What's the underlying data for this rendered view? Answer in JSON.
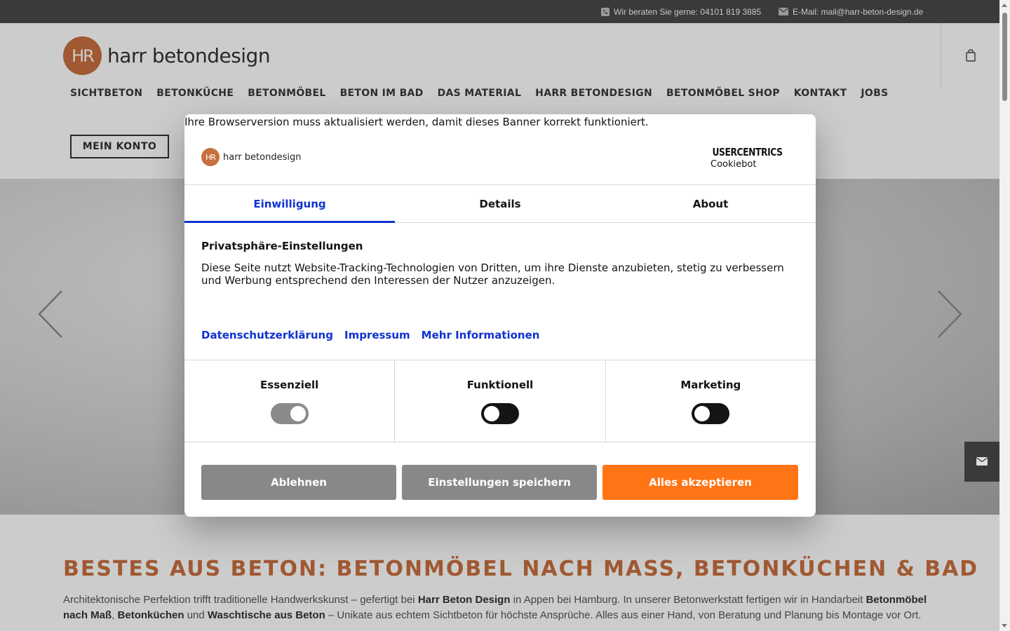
{
  "topbar": {
    "phone_text": "Wir beraten Sie gerne: 04101 819 3885",
    "email_text": "E-Mail: mail@harr-beton-design.de",
    "phone_icon": "phone-icon",
    "email_icon": "envelope-icon"
  },
  "header": {
    "logo_mark": "HR",
    "logo_text": "harr betondesign",
    "nav": [
      "SICHTBETON",
      "BETONKÜCHE",
      "BETONMÖBEL",
      "BETON IM BAD",
      "DAS MATERIAL",
      "HARR BETONDESIGN",
      "BETONMÖBEL SHOP",
      "KONTAKT",
      "JOBS"
    ],
    "account_label": "MEIN KONTO",
    "cart_icon": "shopping-bag-icon"
  },
  "hero": {
    "prev_icon": "chevron-left-icon",
    "next_icon": "chevron-right-icon",
    "side_icon": "envelope-icon"
  },
  "content": {
    "heading": "BESTES AUS BETON: BETONMÖBEL NACH MASS, BETONKÜCHEN & BAD",
    "para": {
      "t1": "Architektonische Perfektion trifft traditionelle Handwerkskunst – gefertigt bei ",
      "b1": "Harr Beton Design",
      "t2": " in Appen bei Hamburg. In unserer Betonwerkstatt fertigen wir in Handarbeit ",
      "b2": "Betonmöbel nach Maß",
      "t3": ", ",
      "b3": "Betonküchen",
      "t4": " und ",
      "b4": "Waschtische aus Beton",
      "t5": " – Unikate aus echtem Sichtbeton für höchste Ansprüche. Alles aus einer Hand, von Beratung und Planung bis Montage vor Ort."
    }
  },
  "dialog": {
    "browser_note": "Ihre Browserversion muss aktualisiert werden, damit dieses Banner korrekt funktioniert.",
    "logo_mark": "HR",
    "logo_text": "harr betondesign",
    "provider_brand": "USERCENTRICS",
    "provider_sub": "Cookiebot",
    "tabs": [
      "Einwilligung",
      "Details",
      "About"
    ],
    "active_tab": "Einwilligung",
    "title": "Privatsphäre-Einstellungen",
    "text": "Diese Seite nutzt Website-Tracking-Technologien von Dritten, um ihre Dienste anzubieten, stetig zu verbessern und Werbung entsprechend den Interessen der Nutzer anzuzeigen.",
    "links": [
      "Datenschutzerklärung",
      "Impressum",
      "Mehr Informationen"
    ],
    "categories": [
      {
        "label": "Essenziell",
        "on": true
      },
      {
        "label": "Funktionell",
        "on": false
      },
      {
        "label": "Marketing",
        "on": false
      }
    ],
    "buttons": {
      "reject": "Ablehnen",
      "save": "Einstellungen speichern",
      "accept": "Alles akzeptieren"
    }
  },
  "colors": {
    "brand": "#c8703f",
    "link_blue": "#1032cf",
    "accept_orange": "#ff7415",
    "topbar": "#3a3a3a"
  }
}
